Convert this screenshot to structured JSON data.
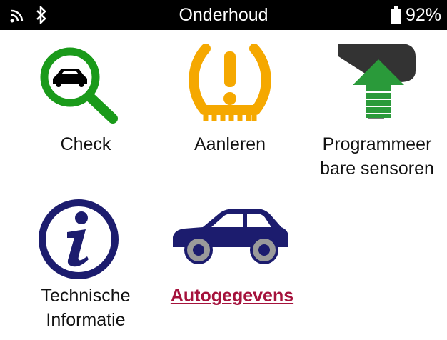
{
  "status_bar": {
    "title": "Onderhoud",
    "battery_percent": "92%",
    "icons": [
      "wifi-signal-icon",
      "bluetooth-icon",
      "battery-icon"
    ]
  },
  "menu": {
    "items": [
      {
        "label": "Check",
        "icon": "magnifier-car-icon",
        "selected": false
      },
      {
        "label": "Aanleren",
        "icon": "tpms-warning-icon",
        "selected": false
      },
      {
        "label": "Programmeer\nbare sensoren",
        "icon": "programmable-sensor-icon",
        "selected": false
      },
      {
        "label": "Technische\nInformatie",
        "icon": "info-icon",
        "selected": false
      },
      {
        "label": "Autogegevens",
        "icon": "car-icon",
        "selected": true
      }
    ]
  },
  "colors": {
    "check_green": "#1a9a1a",
    "tpms_amber": "#f5a800",
    "sensor_green": "#2a9a3a",
    "navy": "#1c1c6e",
    "selected_label": "#a5123c"
  }
}
